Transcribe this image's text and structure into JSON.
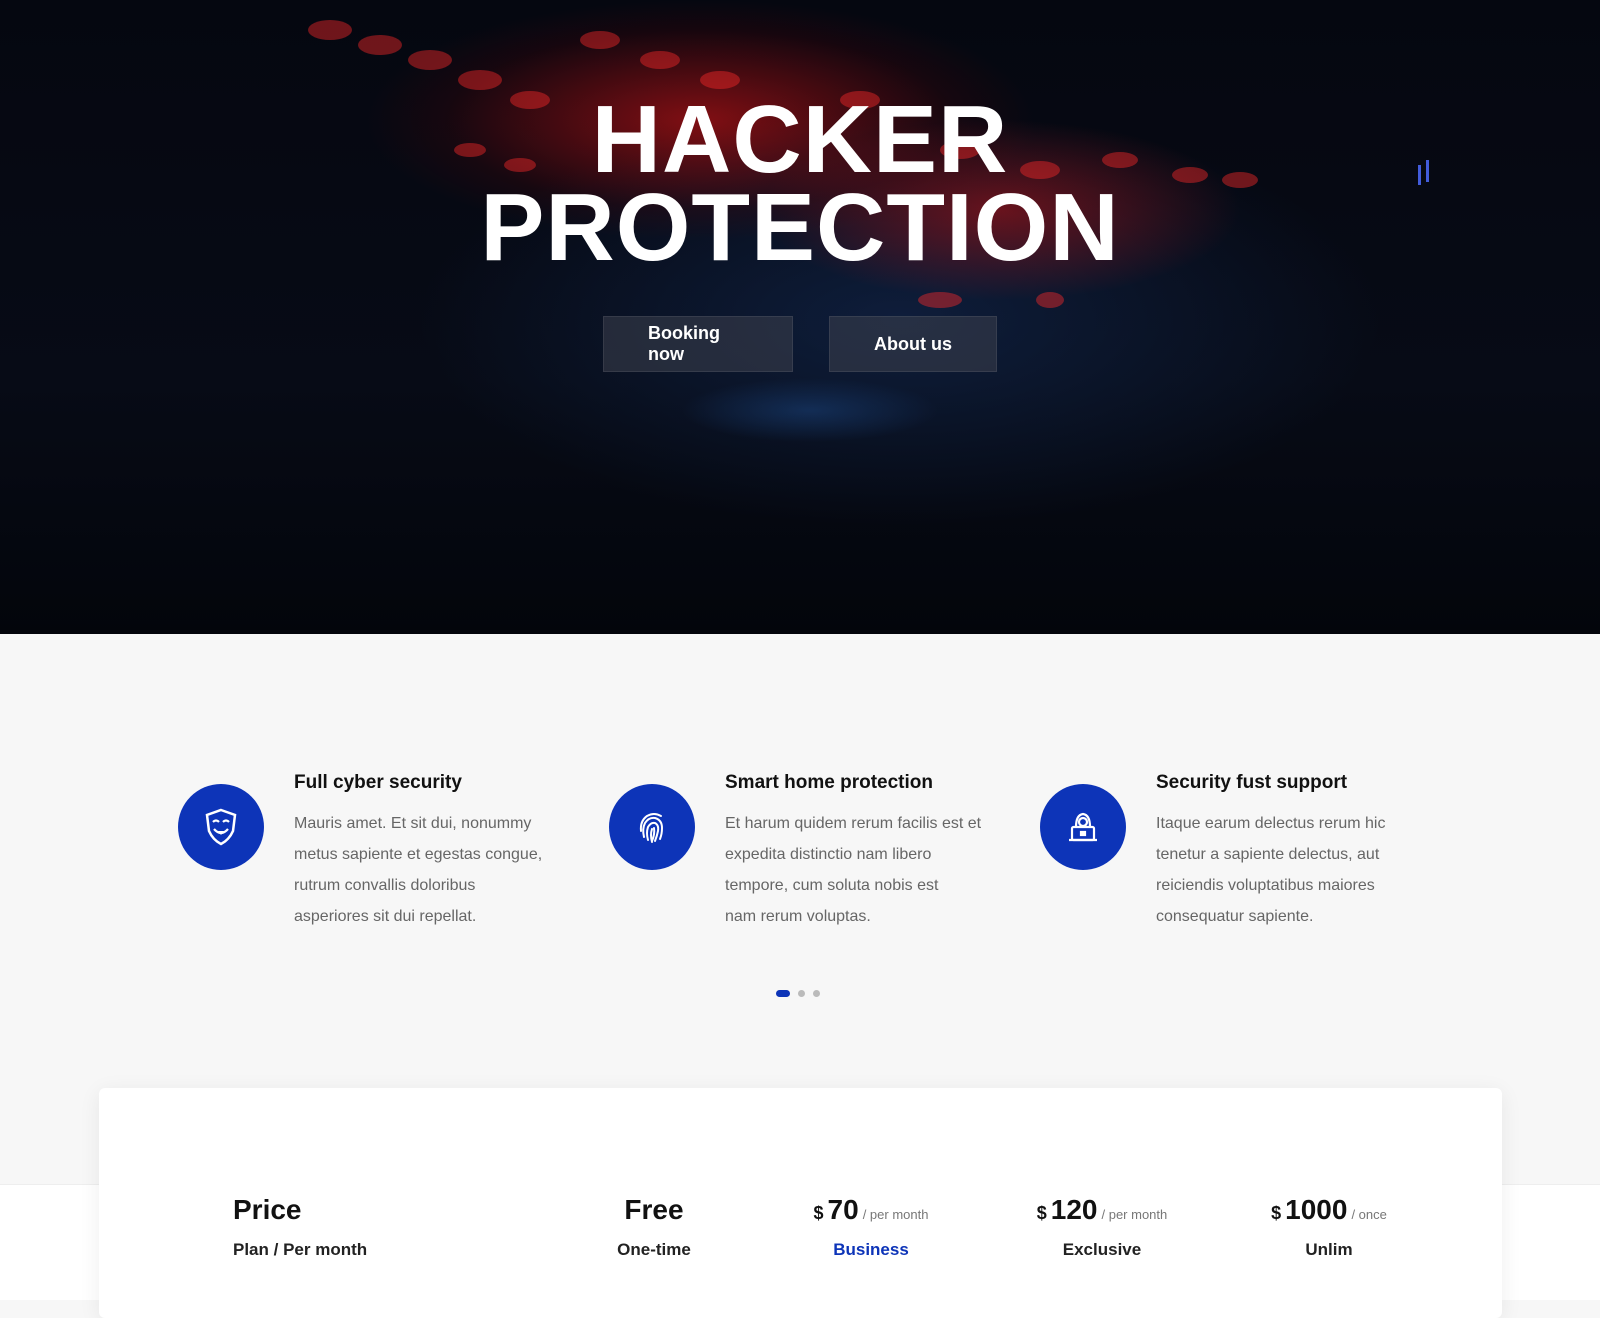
{
  "hero": {
    "title_line1": "HACKER",
    "title_line2": "PROTECTION",
    "booking_label": "Booking now",
    "about_label": "About us"
  },
  "features": [
    {
      "icon": "anonymous-mask-shield-icon",
      "title": "Full cyber security",
      "lines": [
        "Mauris amet. Et sit dui, nonummy",
        "metus sapiente et egestas congue,",
        "rutrum convallis doloribus",
        "asperiores sit dui repellat."
      ]
    },
    {
      "icon": "fingerprint-icon",
      "title": "Smart home protection",
      "lines": [
        "Et harum quidem rerum facilis est et",
        "expedita distinctio nam libero",
        "tempore, cum soluta nobis est",
        "nam rerum voluptas."
      ]
    },
    {
      "icon": "hacker-laptop-icon",
      "title": "Security fust support",
      "lines": [
        "Itaque earum delectus rerum hic",
        "tenetur a sapiente delectus, aut",
        "reiciendis voluptatibus maiores",
        "consequatur sapiente."
      ]
    }
  ],
  "carousel": {
    "total": 3,
    "active": 1
  },
  "pricing": {
    "label": {
      "title": "Price",
      "subtitle": "Plan / Per month"
    },
    "plans": [
      {
        "currency": "",
        "amount": "Free",
        "period": "",
        "name": "One-time"
      },
      {
        "currency": "$",
        "amount": "70",
        "period": "/ per month",
        "name": "Business"
      },
      {
        "currency": "$",
        "amount": "120",
        "period": "/ per month",
        "name": "Exclusive"
      },
      {
        "currency": "$",
        "amount": "1000",
        "period": "/ once",
        "name": "Unlim"
      }
    ]
  },
  "colors": {
    "accent": "#0d34b8",
    "hero_bg": "#05070f"
  }
}
